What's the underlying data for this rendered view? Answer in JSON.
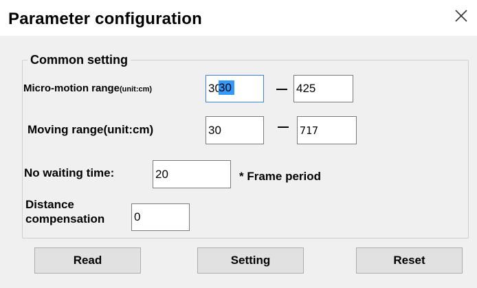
{
  "window": {
    "title": "Parameter configuration",
    "close_icon": "×"
  },
  "common_setting": {
    "group_title": "Common setting",
    "micro_motion": {
      "label": "Micro-motion range",
      "unit_label": "(unit:cm)",
      "min_value": "30",
      "separator": "-",
      "max_value": "425"
    },
    "moving_range": {
      "label": "Moving range(unit:cm)",
      "min_value": "30",
      "separator": "-",
      "max_value": "717"
    },
    "no_waiting_time": {
      "label": "No waiting time:",
      "value": "20",
      "suffix": "* Frame period"
    },
    "distance_compensation": {
      "label_line1": "Distance",
      "label_line2": "compensation",
      "value": "0"
    }
  },
  "buttons": {
    "read_label": "Read",
    "setting_label": "Setting",
    "reset_label": "Reset"
  },
  "colors": {
    "dialog_background": "#f0f0f0",
    "titlebar_background": "#ffffff",
    "focus_border": "#3c82d8",
    "selection_highlight": "#3399ff",
    "button_background": "#e1e1e1"
  }
}
